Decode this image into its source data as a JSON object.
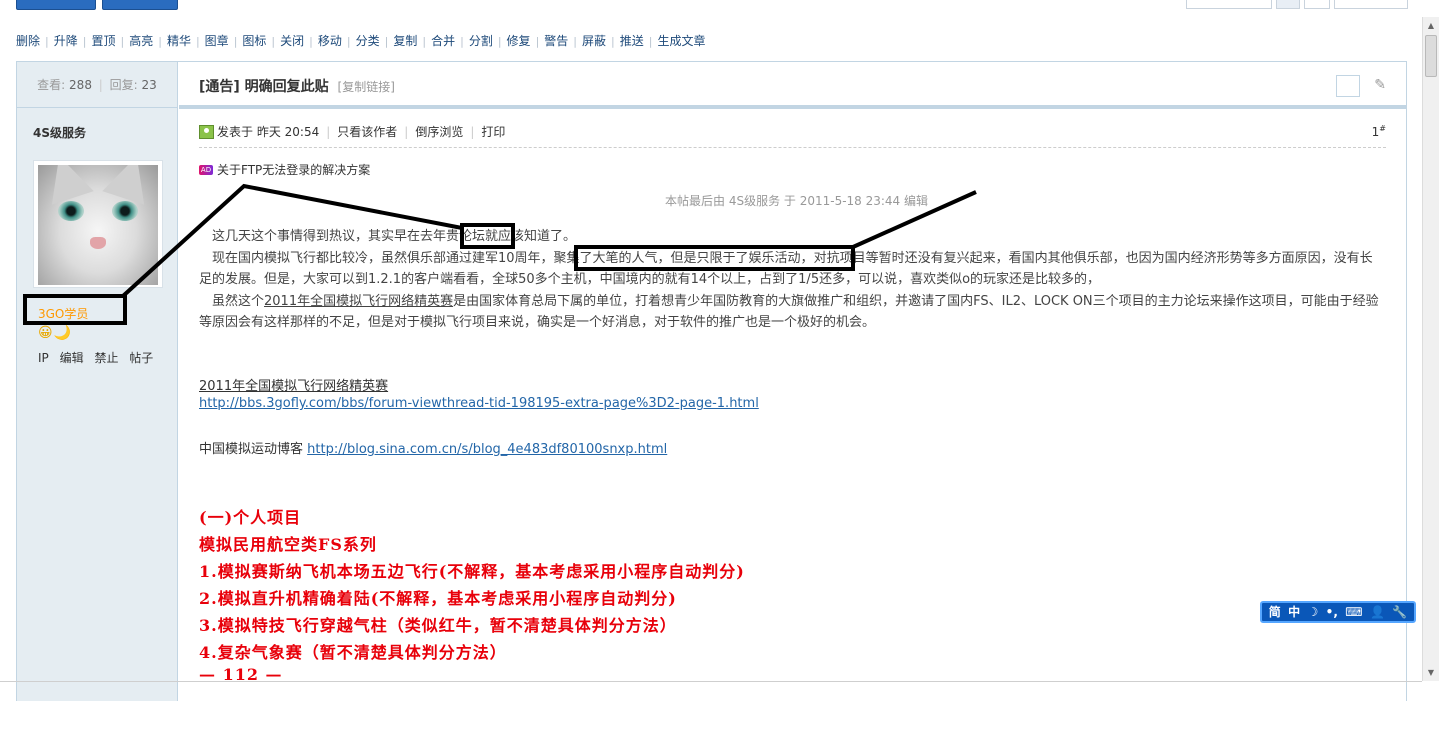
{
  "modbar": [
    "删除",
    "升降",
    "置顶",
    "高亮",
    "精华",
    "图章",
    "图标",
    "关闭",
    "移动",
    "分类",
    "复制",
    "合并",
    "分割",
    "修复",
    "警告",
    "屏蔽",
    "推送",
    "生成文章"
  ],
  "sidebar": {
    "views_label": "查看:",
    "views": "288",
    "replies_label": "回复:",
    "replies": "23",
    "author": "4S级服务",
    "rank": "3GO学员",
    "medals": "😀🌙",
    "links": [
      "IP",
      "编辑",
      "禁止",
      "帖子"
    ]
  },
  "thread": {
    "title": "[通告] 明确回复此贴",
    "copy_link": "[复制链接]",
    "posted": "发表于 昨天 20:54",
    "only_author": "只看该作者",
    "reverse": "倒序浏览",
    "print": "打印",
    "floor": "1",
    "floor_sup": "#",
    "ad_icon": "AD",
    "ad_text": "关于FTP无法登录的解决方案",
    "edited": "本帖最后由 4S级服务 于 2011-5-18 23:44 编辑"
  },
  "body": {
    "p1a": "　这几天这个事情得到热议，其实早在去年",
    "p1b": "贵论坛",
    "p1c": "就应该知道了。",
    "p2a": "　现在国内模拟飞行都比较冷，虽然俱乐部通过建军10周年，",
    "p2b": "聚集了大笔的人气，但是只限于了娱乐活动，",
    "p2c": "对抗项目等暂时还没有复兴起来，看国内其他俱乐部，也因为国内经济形势等多方面原因，没有长足的发展。但是，大家可以到1.2.1的客户端看看，全球50多个主机，中国境内的就有14个以上，占到了1/5还多，可以说，喜欢类似o的玩家还是比较多的，",
    "p3a": "　虽然这个",
    "p3b": "2011年全国模拟飞行网络精英赛",
    "p3c": "是由国家体育总局下属的单位，打着想青少年国防教育的大旗做推广和组织，并邀请了国内FS、IL2、LOCK ON三个项目的主力论坛来操作这项目，可能由于经验等原因会有这样那样的不足，但是对于模拟飞行项目来说，确实是一个好消息，对于软件的推广也是一个极好的机会。",
    "link_title": "2011年全国模拟飞行网络精英赛",
    "link_url": "http://bbs.3gofly.com/bbs/forum-viewthread-tid-198195-extra-page%3D2-page-1.html",
    "blog_label": "中国模拟运动博客 ",
    "blog_url": "http://blog.sina.com.cn/s/blog_4e483df80100snxp.html"
  },
  "red_lines": [
    "(一)个人项目",
    "模拟民用航空类FS系列",
    "1.模拟赛斯纳飞机本场五边飞行(不解释，基本考虑采用小程序自动判分)",
    "2.模拟直升机精确着陆(不解释，基本考虑采用小程序自动判分)",
    "3.模拟特技飞行穿越气柱（类似红牛，暂不清楚具体判分方法）",
    "4.复杂气象赛（暂不清楚具体判分方法）",
    "— 112 —"
  ],
  "ime": [
    "简",
    "中",
    "☽",
    "•,",
    "⌨",
    "👤",
    "🔧"
  ],
  "colors": {
    "accent": "#2a6cbf",
    "border": "#c2d5e3",
    "sidebar_bg": "#e5edf2",
    "red_text": "#e8000a",
    "link": "#2366a8",
    "rank": "#ff9900"
  }
}
